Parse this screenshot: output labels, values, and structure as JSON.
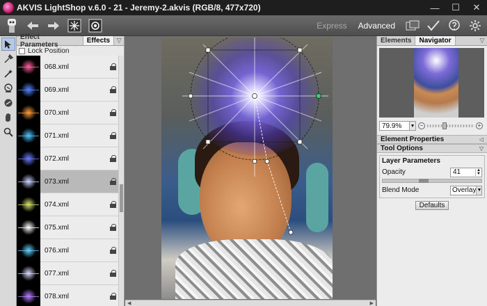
{
  "titlebar": {
    "title": "AKVIS LightShop v.6.0 - 21 - Jeremy-2.akvis (RGB/8, 477x720)",
    "minimize": "—",
    "maximize": "☐",
    "close": "✕"
  },
  "toolbar": {
    "express_label": "Express",
    "advanced_label": "Advanced",
    "active_mode": "Advanced"
  },
  "left_panel": {
    "tabs": [
      "Effect Parameters",
      "Effects"
    ],
    "active_tab": "Effects",
    "lock_position_label": "Lock Position",
    "effects": [
      {
        "name": "068.xml",
        "color": "#ff5fa2"
      },
      {
        "name": "069.xml",
        "color": "#4f86ff"
      },
      {
        "name": "070.xml",
        "color": "#ff9a3c"
      },
      {
        "name": "071.xml",
        "color": "#4fc3ff"
      },
      {
        "name": "072.xml",
        "color": "#6a7bff"
      },
      {
        "name": "073.xml",
        "color": "#c9d2ff"
      },
      {
        "name": "074.xml",
        "color": "#d6e36b"
      },
      {
        "name": "075.xml",
        "color": "#ffffff"
      },
      {
        "name": "076.xml",
        "color": "#62d1ff"
      },
      {
        "name": "077.xml",
        "color": "#d9d9ff"
      },
      {
        "name": "078.xml",
        "color": "#b67dff"
      }
    ],
    "selected_effect": "073.xml"
  },
  "right_panel": {
    "tabs": [
      "Elements",
      "Navigator"
    ],
    "active_tab": "Navigator",
    "zoom_value": "79.9%",
    "zoom_out": "−",
    "zoom_in": "+",
    "element_properties_label": "Element Properties",
    "tool_options_label": "Tool Options",
    "layer_parameters_label": "Layer Parameters",
    "opacity_label": "Opacity",
    "opacity_value": "41",
    "blend_mode_label": "Blend Mode",
    "blend_mode_value": "Overlay",
    "defaults_label": "Defaults"
  }
}
